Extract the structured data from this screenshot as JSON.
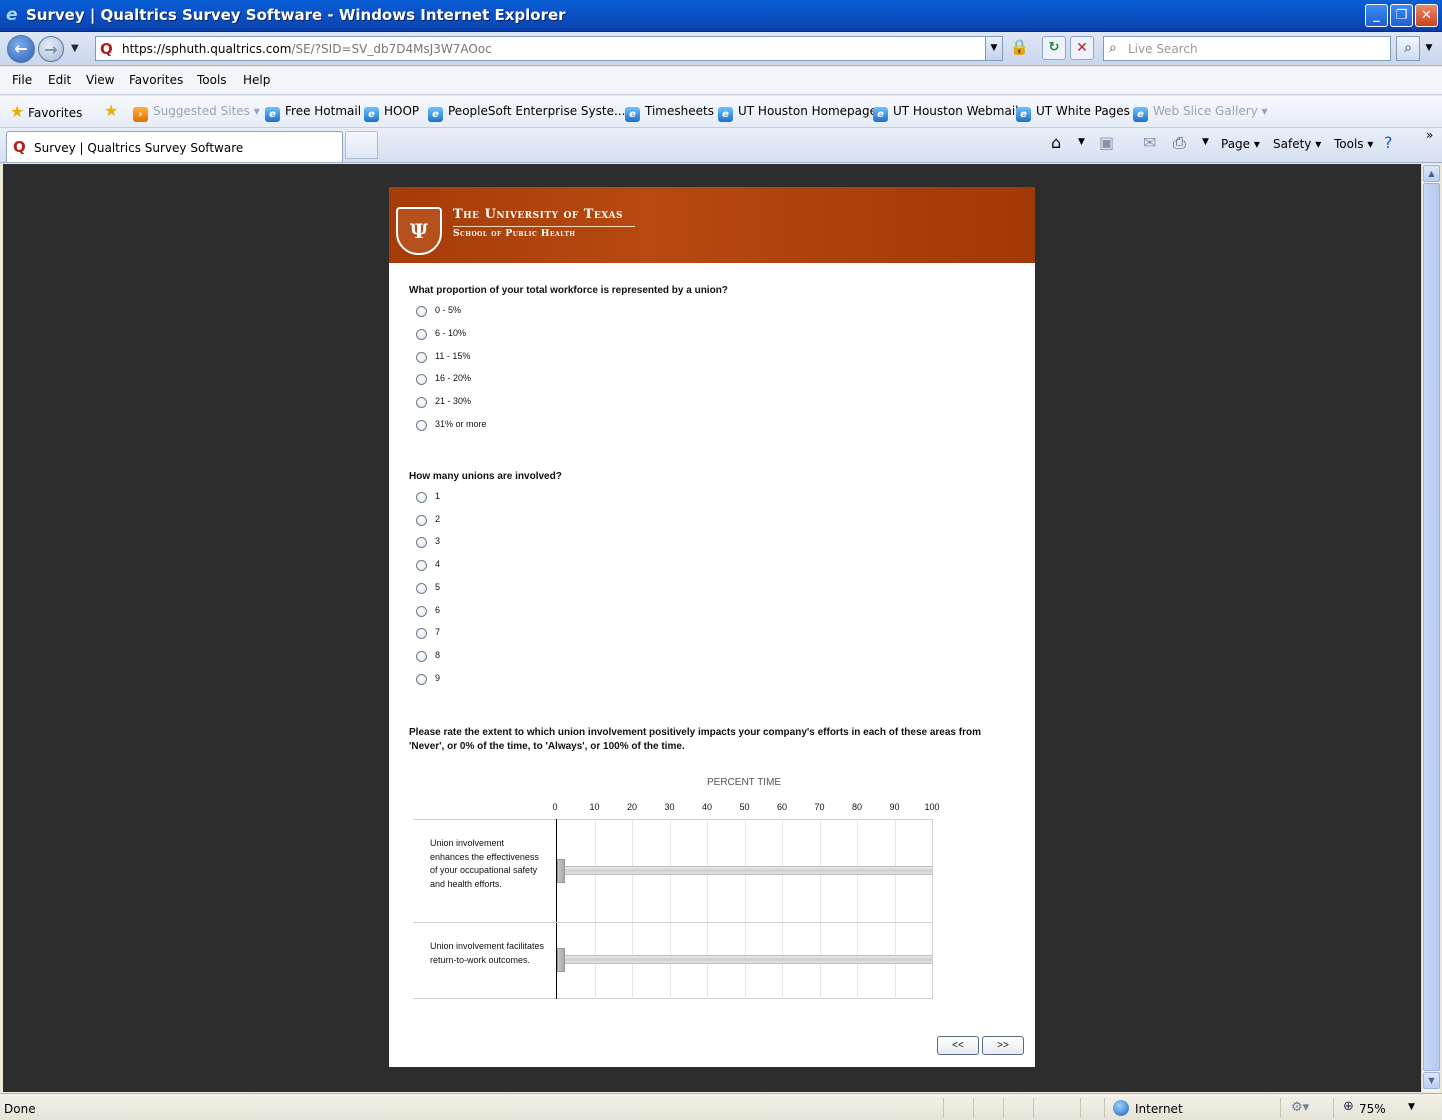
{
  "window": {
    "title": "Survey | Qualtrics Survey Software - Windows Internet Explorer",
    "minimize": "_",
    "maximize": "❐",
    "close": "✕"
  },
  "address_bar": {
    "url_scheme": "https://",
    "url_host": "sphuth.qualtrics.com",
    "url_path": "/SE/?SID=SV_db7D4MsJ3W7AOoc",
    "search_placeholder": "Live Search"
  },
  "menu": [
    "File",
    "Edit",
    "View",
    "Favorites",
    "Tools",
    "Help"
  ],
  "favorites_bar": {
    "favorites_label": "Favorites",
    "items": [
      "Suggested Sites ▾",
      "Free Hotmail",
      "HOOP",
      "PeopleSoft Enterprise Syste...",
      "Timesheets",
      "UT Houston Homepage",
      "UT Houston Webmail",
      "UT White Pages",
      "Web Slice Gallery ▾"
    ]
  },
  "tab": {
    "label": "Survey | Qualtrics Survey Software"
  },
  "command_bar": {
    "page": "Page ▾",
    "safety": "Safety ▾",
    "tools": "Tools ▾",
    "chevron": "»"
  },
  "survey": {
    "university": "The University of Texas",
    "school": "School of Public Health",
    "q1": {
      "text": "What proportion of your total workforce is represented by a union?",
      "options": [
        "0 - 5%",
        "6 - 10%",
        "11 - 15%",
        "16 - 20%",
        "21 - 30%",
        "31% or more"
      ]
    },
    "q2": {
      "text": "How many unions are involved?",
      "options": [
        "1",
        "2",
        "3",
        "4",
        "5",
        "6",
        "7",
        "8",
        "9"
      ]
    },
    "q3": {
      "text": "Please rate the extent to which union involvement positively impacts your company's efforts in each of these areas from 'Never', or 0% of the time, to 'Always', or 100% of the time.",
      "scale_header": "PERCENT TIME",
      "ticks": [
        "0",
        "10",
        "20",
        "30",
        "40",
        "50",
        "60",
        "70",
        "80",
        "90",
        "100"
      ],
      "statements": [
        {
          "text": "Union involvement enhances the effectiveness of your occupational safety and health efforts.",
          "value": 0
        },
        {
          "text": "Union involvement facilitates return-to-work outcomes.",
          "value": 0
        }
      ]
    },
    "prev_label": "<<",
    "next_label": ">>"
  },
  "status_bar": {
    "status": "Done",
    "zone": "Internet",
    "zoom": "75%"
  }
}
